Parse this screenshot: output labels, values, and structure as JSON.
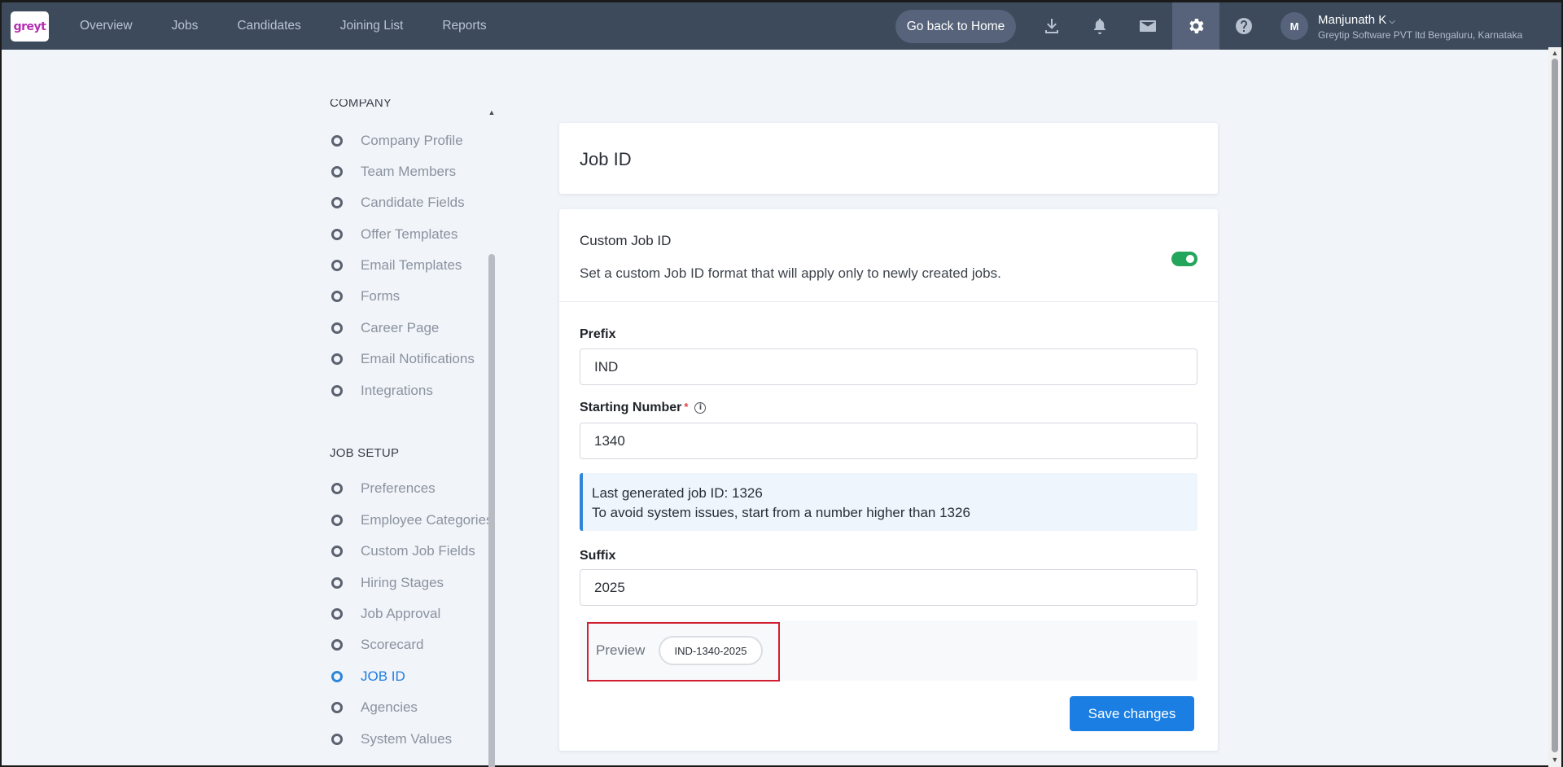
{
  "app": {
    "logo_text": "greyt"
  },
  "nav": {
    "items": [
      {
        "label": "Overview"
      },
      {
        "label": "Jobs"
      },
      {
        "label": "Candidates"
      },
      {
        "label": "Joining List"
      },
      {
        "label": "Reports"
      }
    ],
    "home_button": "Go back to Home",
    "icons": [
      "download-icon",
      "bell-icon",
      "mail-icon",
      "gear-icon",
      "help-icon"
    ]
  },
  "user": {
    "initial": "M",
    "name": "Manjunath K",
    "org": "Greytip Software PVT ltd Bengaluru, Karnataka"
  },
  "sidebar": {
    "company_title": "COMPANY",
    "company_items": [
      {
        "label": "Company Profile"
      },
      {
        "label": "Team Members"
      },
      {
        "label": "Candidate Fields"
      },
      {
        "label": "Offer Templates"
      },
      {
        "label": "Email Templates"
      },
      {
        "label": "Forms"
      },
      {
        "label": "Career Page"
      },
      {
        "label": "Email Notifications"
      },
      {
        "label": "Integrations"
      }
    ],
    "job_setup_title": "JOB SETUP",
    "job_setup_items": [
      {
        "label": "Preferences"
      },
      {
        "label": "Employee Categories"
      },
      {
        "label": "Custom Job Fields"
      },
      {
        "label": "Hiring Stages"
      },
      {
        "label": "Job Approval"
      },
      {
        "label": "Scorecard"
      },
      {
        "label": "JOB ID"
      },
      {
        "label": "Agencies"
      },
      {
        "label": "System Values"
      }
    ],
    "active_item": "JOB ID"
  },
  "main": {
    "page_title": "Job ID",
    "custom_job_id": {
      "title": "Custom Job ID",
      "description": "Set a custom Job ID format that will apply only to newly created jobs.",
      "enabled": true
    },
    "prefix": {
      "label": "Prefix",
      "value": "IND"
    },
    "starting_number": {
      "label": "Starting Number",
      "required_mark": "*",
      "info_icon": "i",
      "value": "1340"
    },
    "notice": {
      "line1": "Last generated job ID: 1326",
      "line2": "To avoid system issues, start from a number higher than 1326"
    },
    "suffix": {
      "label": "Suffix",
      "value": "2025"
    },
    "preview": {
      "label": "Preview",
      "value": "IND-1340-2025"
    },
    "save_button": "Save changes"
  },
  "colors": {
    "topbar": "#3c4a5c",
    "accent": "#1a7ee3",
    "toggle_on": "#23a55b",
    "highlight": "#d21f2f"
  }
}
